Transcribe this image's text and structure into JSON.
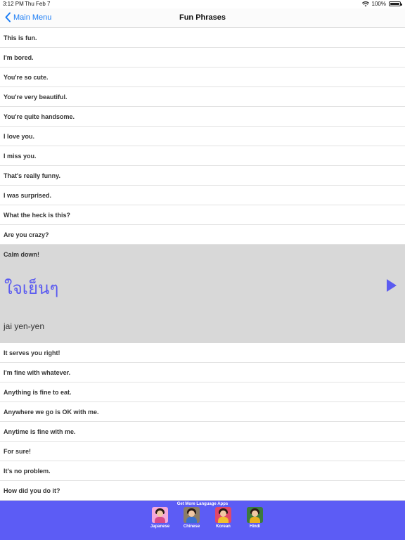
{
  "status_bar": {
    "time": "3:12 PM",
    "date": "Thu Feb 7",
    "battery": "100%"
  },
  "nav": {
    "back_label": "Main Menu",
    "title": "Fun Phrases"
  },
  "phrases_before": [
    "This is fun.",
    "I'm bored.",
    "You're so cute.",
    "You're very beautiful.",
    "You're quite handsome.",
    "I love you.",
    "I miss you.",
    "That's really funny.",
    "I was surprised.",
    "What the heck is this?",
    "Are you crazy?"
  ],
  "expanded": {
    "phrase": "Calm down!",
    "thai": "ใจเย็นๆ",
    "romanized": "jai yen-yen"
  },
  "phrases_after": [
    "It serves you right!",
    "I'm fine with whatever.",
    "Anything is fine to eat.",
    "Anywhere we go is OK with me.",
    "Anytime is fine with me.",
    "For sure!",
    "It's no problem.",
    "How did you do it?"
  ],
  "footer": {
    "promo": "Get More Language Apps",
    "apps": [
      {
        "label": "Japanese",
        "bg": "#f6a8d8",
        "body": "#d94a8a",
        "icon": "japanese-app-icon"
      },
      {
        "label": "Chinese",
        "bg": "#8a7c66",
        "body": "#3a6fd0",
        "icon": "chinese-app-icon"
      },
      {
        "label": "Korean",
        "bg": "#e0486a",
        "body": "#f0c030",
        "icon": "korean-app-icon"
      },
      {
        "label": "Hindi",
        "bg": "#3c7a3c",
        "body": "#e8b020",
        "icon": "hindi-app-icon"
      }
    ]
  },
  "colors": {
    "accent": "#1a7cf5",
    "footer_bg": "#5c5cf5",
    "thai_text": "#5b5bf0",
    "expanded_bg": "#d8d8d8"
  }
}
